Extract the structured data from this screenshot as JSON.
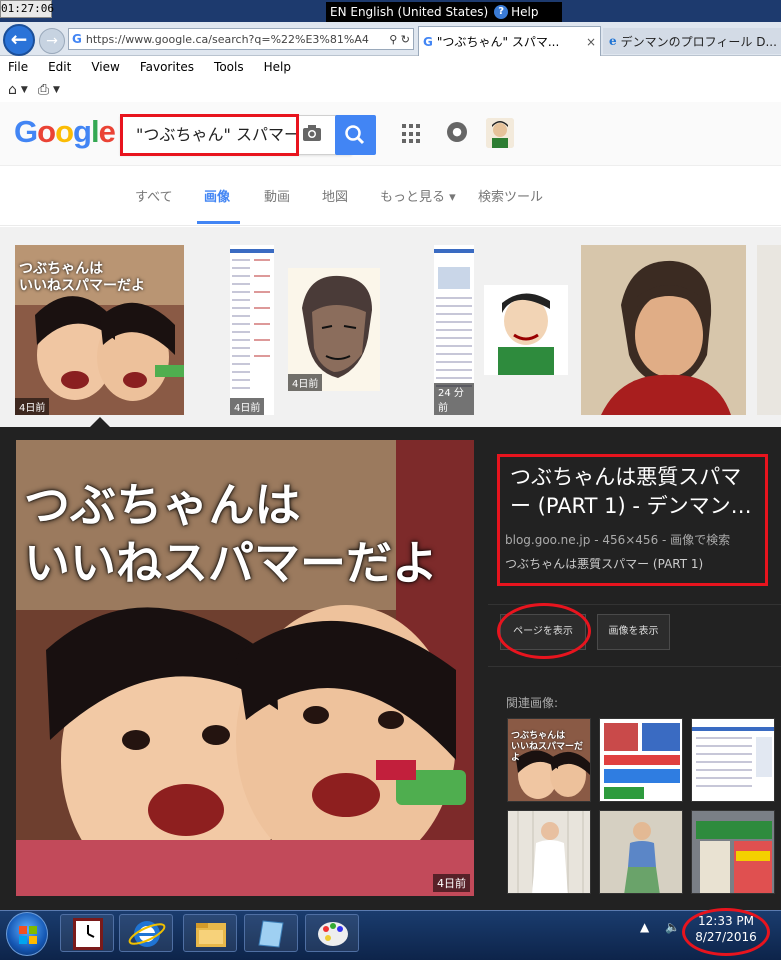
{
  "system": {
    "clock": "01:27:06",
    "language": "EN English (United States)",
    "help": "Help"
  },
  "browser": {
    "url": "https://www.google.ca/search?q=%22%E3%81%A4",
    "tabs": [
      {
        "title": "\"つぶちゃん\" スパマ...",
        "icon": "G",
        "close": "×"
      },
      {
        "title": "デンマンのプロフィール D...",
        "icon": "e"
      }
    ],
    "menu": [
      "File",
      "Edit",
      "View",
      "Favorites",
      "Tools",
      "Help"
    ]
  },
  "google": {
    "logo": "Google",
    "query": "\"つぶちゃん\" スパマー",
    "tabs": [
      "すべて",
      "画像",
      "動画",
      "地図",
      "もっと見る ▾",
      "検索ツール"
    ],
    "selected_tab": "画像"
  },
  "thumbnails": [
    {
      "label": "4日前",
      "overlay_line1": "つぶちゃんは",
      "overlay_line2": "いいねスパマーだよ"
    },
    {
      "label": "4日前"
    },
    {
      "label": "4日前"
    },
    {
      "label": "24 分前"
    },
    {
      "label": ""
    },
    {
      "label": ""
    }
  ],
  "panel": {
    "image_text_line1": "つぶちゃんは",
    "image_text_line2": "いいねスパマーだよ",
    "image_age": "4日前",
    "title": "つぶちゃんは悪質スパマー (PART 1) - デンマン…",
    "meta": "blog.goo.ne.jp - 456×456 - 画像で検索",
    "subtitle": "つぶちゃんは悪質スパマー (PART 1)",
    "btn_page": "ページを表示",
    "btn_image": "画像を表示",
    "related_label": "関連画像:",
    "related_text_line1": "つぶちゃんは",
    "related_text_line2": "いいねスパマーだよ"
  },
  "taskbar": {
    "time": "12:33 PM",
    "date": "8/27/2016"
  },
  "colors": {
    "google_blue": "#4285f4",
    "annotation_red": "#e8141e",
    "panel_bg": "#222222"
  }
}
